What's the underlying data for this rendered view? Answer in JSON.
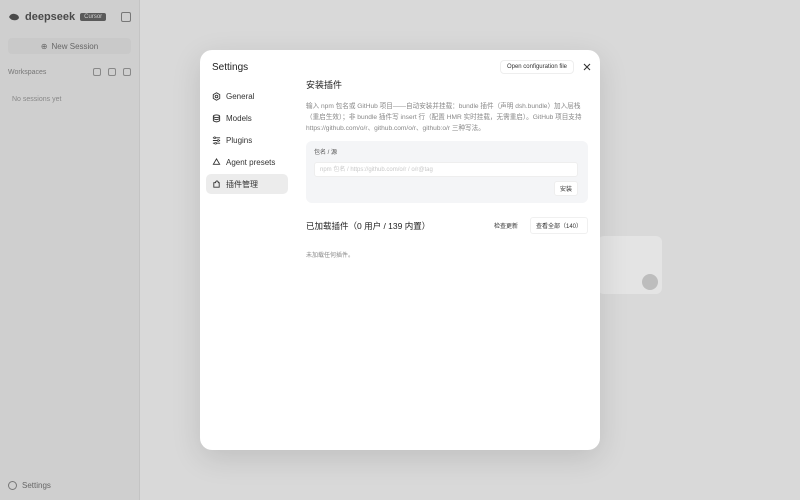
{
  "sidebar": {
    "brand": "deepseek",
    "badge": "Cursor",
    "new_session": "New Session",
    "workspace_label": "Workspaces",
    "no_sessions": "No sessions yet",
    "settings": "Settings"
  },
  "modal": {
    "title": "Settings",
    "open_config": "Open configuration file",
    "nav": [
      {
        "label": "General",
        "icon": "gear-icon"
      },
      {
        "label": "Models",
        "icon": "database-icon"
      },
      {
        "label": "Plugins",
        "icon": "sliders-icon"
      },
      {
        "label": "Agent presets",
        "icon": "recycle-icon"
      },
      {
        "label": "插件管理",
        "icon": "puzzle-icon"
      }
    ],
    "install": {
      "title": "安装插件",
      "desc": "输入 npm 包名或 GitHub 项目——自动安装并挂载：bundle 插件（声明 dsh.bundle）加入层栈（重启生效）；非 bundle 插件写 insert 行（配置 HMR 实时挂载，无需重启）。GitHub 项目支持 https://github.com/o/r、github.com/o/r、github:o/r 三种写法。",
      "field_label": "包名 / 源",
      "placeholder": "npm 包名 / https://github.com/o/r / o/r@tag",
      "button": "安装"
    },
    "loaded": {
      "title": "已加载插件（0 用户 / 139 内置）",
      "check_updates": "检查更新",
      "view_all": "查看全部（140）",
      "empty": "未加载任何插件。"
    }
  }
}
